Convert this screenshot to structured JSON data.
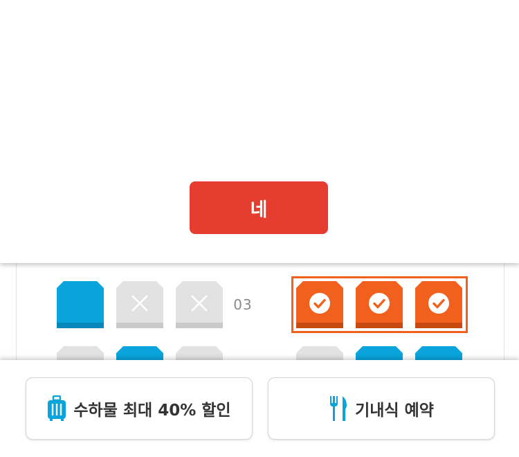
{
  "dialog": {
    "confirm_label": "네"
  },
  "seat_map": {
    "row_number": "03",
    "colors": {
      "available": "#0aa4dc",
      "occupied": "#e2e2e2",
      "selected": "#f2601e",
      "confirm": "#e53d30"
    },
    "row_03": {
      "left": [
        "available",
        "occupied",
        "occupied"
      ],
      "right": [
        "selected",
        "selected",
        "selected"
      ]
    },
    "row_04_partial": {
      "left": [
        "occupied",
        "available",
        "occupied"
      ],
      "right": [
        "occupied",
        "available",
        "available"
      ]
    }
  },
  "bottom_bar": {
    "baggage_label": "수하물 최대 40% 할인",
    "baggage_icon": "luggage-icon",
    "meal_label": "기내식 예약",
    "meal_icon": "fork-knife-icon"
  }
}
